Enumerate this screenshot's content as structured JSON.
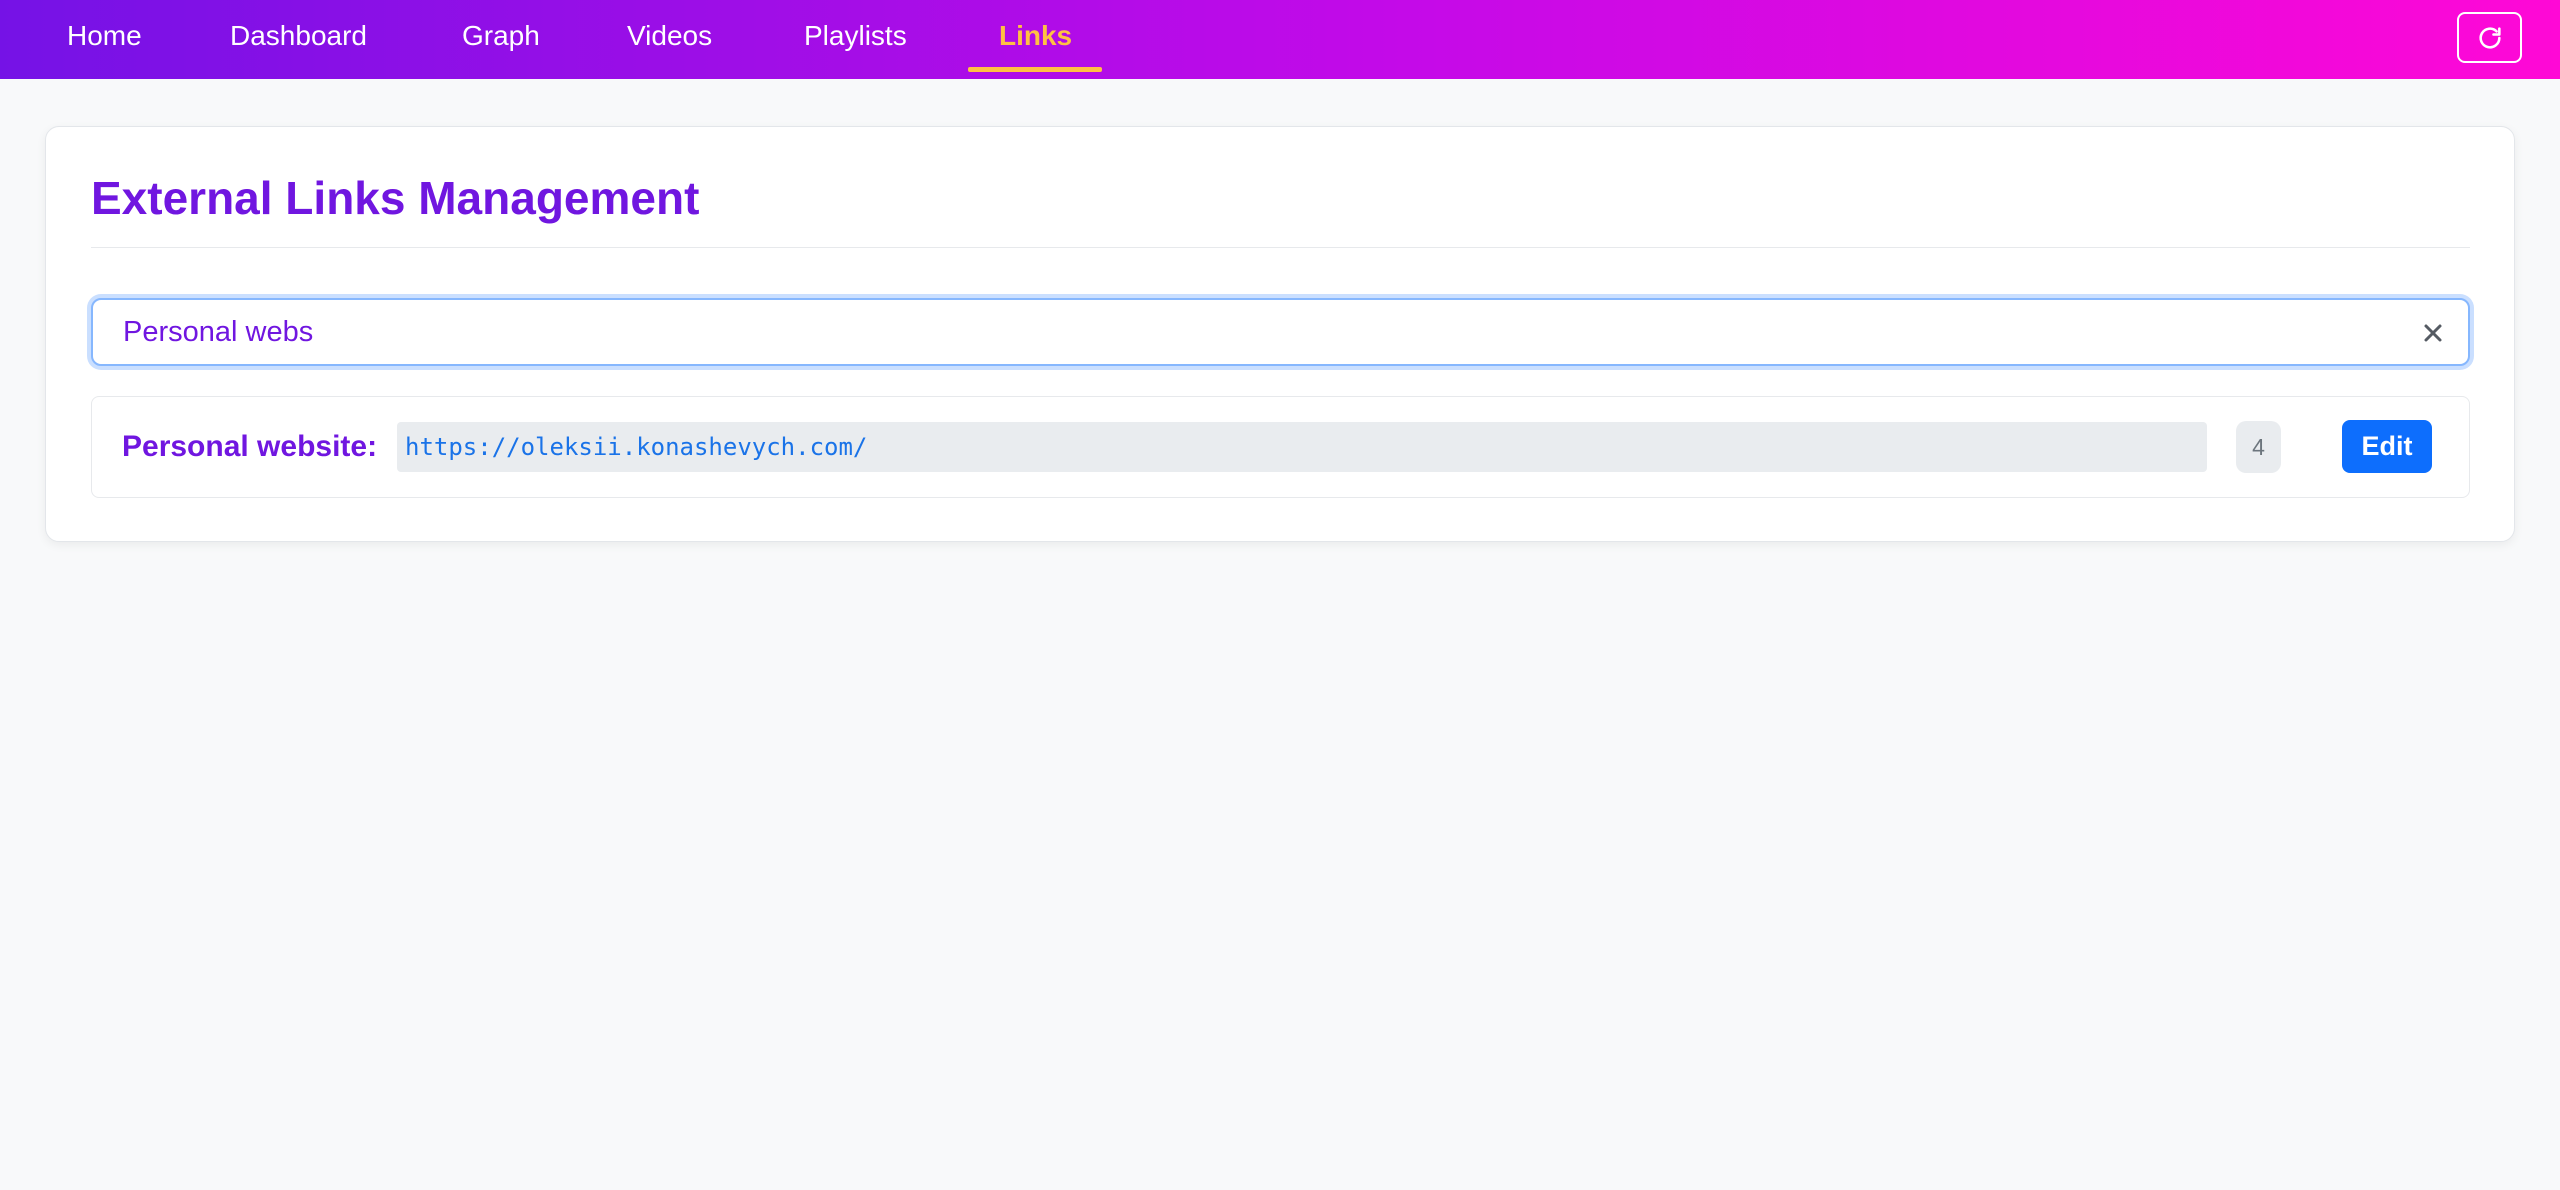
{
  "nav": {
    "items": [
      {
        "label": "Home",
        "active": false
      },
      {
        "label": "Dashboard",
        "active": false
      },
      {
        "label": "Graph",
        "active": false
      },
      {
        "label": "Videos",
        "active": false
      },
      {
        "label": "Playlists",
        "active": false
      },
      {
        "label": "Links",
        "active": true
      }
    ],
    "refresh_icon": "refresh-icon"
  },
  "page": {
    "title": "External Links Management"
  },
  "search": {
    "value": "Personal webs",
    "clear_icon": "close-icon"
  },
  "links": [
    {
      "label": "Personal website:",
      "url": "https://oleksii.konashevych.com/",
      "count": "4",
      "edit_label": "Edit"
    }
  ],
  "colors": {
    "accent": "#7016e0",
    "nav_active": "#ffc043",
    "primary_button": "#0d6efd",
    "link_text": "#1a73e8"
  }
}
